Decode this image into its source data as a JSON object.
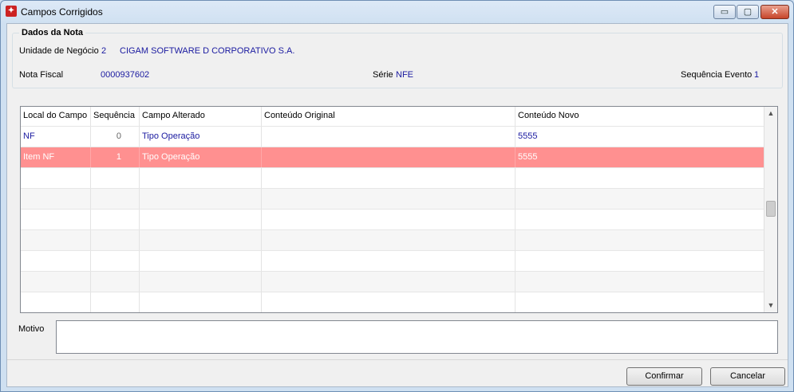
{
  "window": {
    "title": "Campos Corrigidos",
    "icon": "app-logo-icon",
    "controls": {
      "minimize": "▭",
      "maximize": "▢",
      "close": "✕"
    }
  },
  "nota": {
    "group_label": "Dados da Nota",
    "unidade_label": "Unidade de Negócio",
    "unidade_code": "2",
    "unidade_name": "CIGAM SOFTWARE D CORPORATIVO S.A.",
    "nota_label": "Nota Fiscal",
    "nota_value": "0000937602",
    "serie_label": "Série",
    "serie_value": "NFE",
    "sequencia_label": "Sequência Evento",
    "sequencia_value": "1"
  },
  "grid": {
    "columns": [
      "Local do Campo",
      "Sequência",
      "Campo Alterado",
      "Conteúdo Original",
      "Conteúdo Novo"
    ],
    "rows": [
      {
        "local": "NF",
        "sequencia": "0",
        "campo": "Tipo Operação",
        "original": "",
        "novo": "5555"
      },
      {
        "local": "Item NF",
        "sequencia": "1",
        "campo": "Tipo Operação",
        "original": "",
        "novo": "5555"
      }
    ],
    "selected_row": 1
  },
  "motivo": {
    "label": "Motivo",
    "value": ""
  },
  "buttons": {
    "confirm": "Confirmar",
    "cancel": "Cancelar"
  },
  "colors": {
    "selected_row": "#ff9090",
    "value_text": "#1a1aa0"
  }
}
